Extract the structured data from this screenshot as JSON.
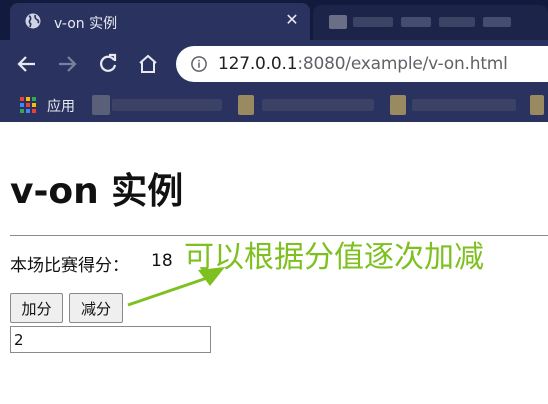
{
  "browser": {
    "tab": {
      "title": "v-on 实例",
      "close": "✕",
      "favicon": "globe-icon"
    },
    "toolbar": {
      "back": "back-arrow-icon",
      "forward": "forward-arrow-icon",
      "reload": "reload-icon",
      "home": "home-icon",
      "url_host": "127.0.0.1",
      "url_rest": ":8080/example/v-on.html"
    },
    "bookmarks": {
      "apps_label": "应用",
      "apps_icon": "apps-grid-icon"
    }
  },
  "page": {
    "heading": "v-on 实例",
    "score_label": "本场比赛得分：",
    "score_value": "18",
    "add_button": "加分",
    "subtract_button": "减分",
    "step_input_value": "2",
    "annotation": "可以根据分值逐次加减",
    "annotation_color": "#7dc01f"
  },
  "colors": {
    "tabbar": "#121a3e",
    "toolbar": "#2a3360",
    "accent_annotation": "#7dc01f"
  }
}
